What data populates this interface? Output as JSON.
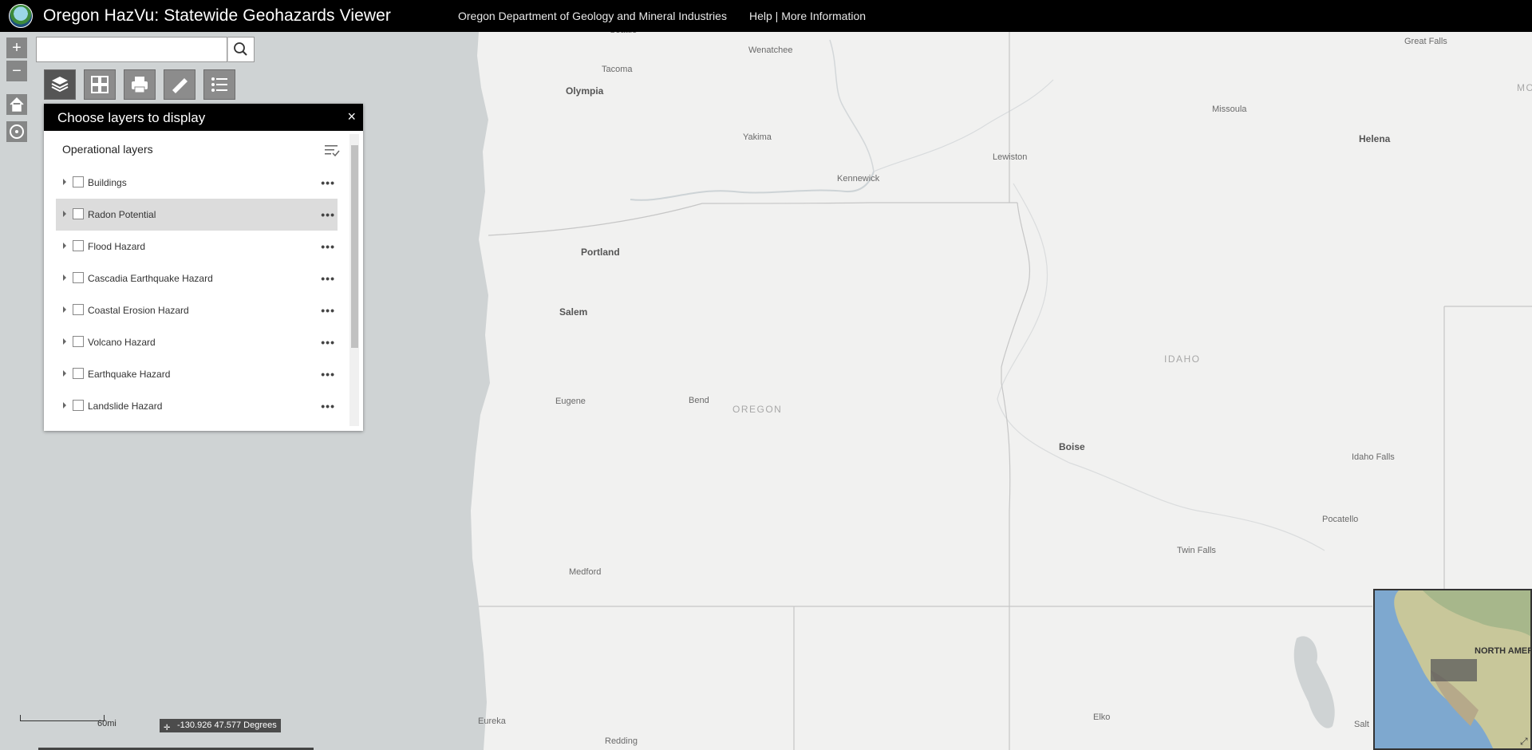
{
  "header": {
    "title": "Oregon HazVu: Statewide Geohazards Viewer",
    "org_link": "Oregon Department of Geology and Mineral Industries",
    "help_link": "Help | More Information"
  },
  "search": {
    "value": "",
    "placeholder": ""
  },
  "tools": [
    "layers-icon",
    "basemap-icon",
    "print-icon",
    "measure-icon",
    "legend-icon"
  ],
  "panel": {
    "title": "Choose layers to display",
    "close": "×",
    "section": "Operational layers",
    "layers": [
      {
        "label": "Buildings",
        "checked": false
      },
      {
        "label": "Radon Potential",
        "checked": false,
        "highlighted": true
      },
      {
        "label": "Flood Hazard",
        "checked": false
      },
      {
        "label": "Cascadia Earthquake Hazard",
        "checked": false
      },
      {
        "label": "Coastal Erosion Hazard",
        "checked": false
      },
      {
        "label": "Volcano Hazard",
        "checked": false
      },
      {
        "label": "Earthquake Hazard",
        "checked": false
      },
      {
        "label": "Landslide Hazard",
        "checked": false
      }
    ],
    "more": "•••"
  },
  "map": {
    "cities": [
      "Seattle",
      "Tacoma",
      "Olympia",
      "Wenatchee",
      "Yakima",
      "Kennewick",
      "Lewiston",
      "Missoula",
      "Great Falls",
      "Helena",
      "Portland",
      "Salem",
      "Eugene",
      "Bend",
      "Boise",
      "Idaho Falls",
      "Pocatello",
      "Twin Falls",
      "Medford",
      "Eureka",
      "Redding",
      "Elko",
      "Salt"
    ],
    "states": [
      "OREGON",
      "IDAHO",
      "MO"
    ],
    "overview_label": "NORTH AMERIC"
  },
  "footer": {
    "scale": "60mi",
    "coordinates": "-130.926 47.577 Degrees"
  },
  "colors": {
    "header": "#000000",
    "ocean": "#cfd3d4",
    "land": "#f1f1f0"
  }
}
